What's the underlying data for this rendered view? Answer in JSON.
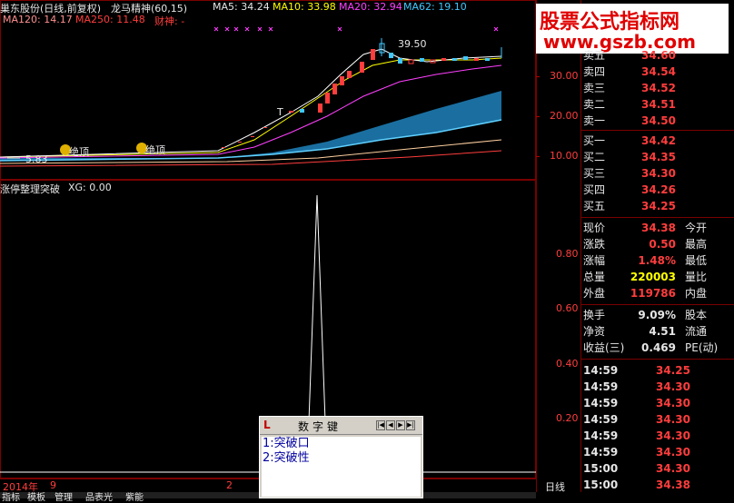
{
  "header": {
    "title": "巢东股份(日线,前复权)",
    "indicator": "龙马精神(60,15)",
    "ma5": "MA5: 34.24",
    "ma10": "MA10: 33.98",
    "ma20": "MA20: 32.94",
    "ma62": "MA62: 19.10",
    "ma120": "MA120: 14.17",
    "ma250": "MA250: 11.48",
    "caishen": "财神: -"
  },
  "main_chart": {
    "price_axis": [
      "30.00",
      "20.00",
      "10.00"
    ],
    "max_label": "39.50",
    "min_label": "5.83",
    "markers": [
      "绝顶",
      "绝顶"
    ],
    "t_marker": "T"
  },
  "sub_chart": {
    "title": "涨停整理突破",
    "xg": "XG: 0.00",
    "axis": [
      "0.80",
      "0.60",
      "0.40",
      "0.20"
    ]
  },
  "time_axis": {
    "year": "2014年",
    "month1": "9",
    "month2": "2",
    "period": "日线"
  },
  "bottom_tabs": [
    "指标",
    "模板",
    "管理",
    "品表光",
    "紫能"
  ],
  "watermark": {
    "line1": "股票公式指标网",
    "line2": "www.gszb.com"
  },
  "order_book": {
    "sell": [
      {
        "label": "卖五",
        "price": "34.60"
      },
      {
        "label": "卖四",
        "price": "34.54"
      },
      {
        "label": "卖三",
        "price": "34.52"
      },
      {
        "label": "卖二",
        "price": "34.51"
      },
      {
        "label": "卖一",
        "price": "34.50"
      }
    ],
    "buy": [
      {
        "label": "买一",
        "price": "34.42"
      },
      {
        "label": "买二",
        "price": "34.35"
      },
      {
        "label": "买三",
        "price": "34.30"
      },
      {
        "label": "买四",
        "price": "34.26"
      },
      {
        "label": "买五",
        "price": "34.25"
      }
    ]
  },
  "stats": [
    {
      "label": "现价",
      "value": "34.38",
      "label2": "今开",
      "color": "#ff3d3d"
    },
    {
      "label": "涨跌",
      "value": "0.50",
      "label2": "最高",
      "color": "#ff3d3d"
    },
    {
      "label": "涨幅",
      "value": "1.48%",
      "label2": "最低",
      "color": "#ff3d3d"
    },
    {
      "label": "总量",
      "value": "220003",
      "label2": "量比",
      "color": "#ffff00"
    },
    {
      "label": "外盘",
      "value": "119786",
      "label2": "内盘",
      "color": "#ff3d3d"
    },
    {
      "label": "换手",
      "value": "9.09%",
      "label2": "股本",
      "color": "#e6e6e6"
    },
    {
      "label": "净资",
      "value": "4.51",
      "label2": "流通",
      "color": "#e6e6e6"
    },
    {
      "label": "收益(三)",
      "value": "0.469",
      "label2": "PE(动)",
      "color": "#e6e6e6"
    }
  ],
  "ticks": [
    {
      "time": "14:59",
      "price": "34.25"
    },
    {
      "time": "14:59",
      "price": "34.30"
    },
    {
      "time": "14:59",
      "price": "34.30"
    },
    {
      "time": "14:59",
      "price": "34.30"
    },
    {
      "time": "14:59",
      "price": "34.30"
    },
    {
      "time": "14:59",
      "price": "34.30"
    },
    {
      "time": "15:00",
      "price": "34.30"
    },
    {
      "time": "15:00",
      "price": "34.38"
    }
  ],
  "popup": {
    "title": "数字键",
    "items": [
      "1:突破口",
      "2:突破性"
    ]
  },
  "colors": {
    "up": "#ff3d3d",
    "down": "#40c8ff",
    "ma5": "#ffffff",
    "ma10": "#ffff00",
    "ma20": "#ff40ff",
    "ma62": "#00c000",
    "band": "#1a6fa0"
  }
}
